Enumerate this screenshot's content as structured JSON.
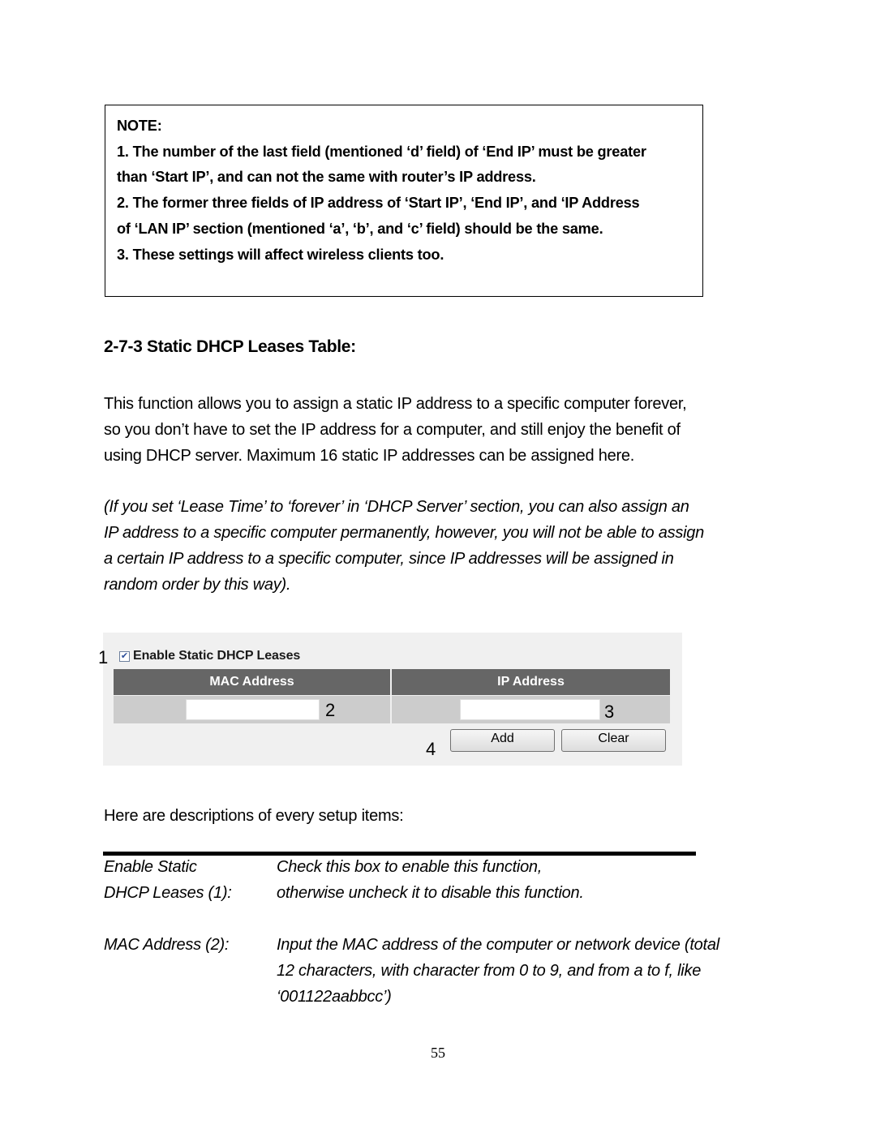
{
  "note": {
    "title": "NOTE:",
    "lines": [
      "1. The number of the last field (mentioned ‘d’ field) of ‘End IP’ must be greater",
      "than ‘Start IP’, and can not the same with router’s IP address.",
      "2. The former three fields of IP address of ‘Start IP’, ‘End IP’, and ‘IP Address",
      "of ‘LAN IP’ section (mentioned ‘a’, ‘b’, and ‘c’ field) should be the same.",
      "3. These settings will affect wireless clients too."
    ]
  },
  "section": {
    "heading": "2-7-3 Static DHCP Leases Table:",
    "intro_lines": [
      "This function allows you to assign a static IP address to a specific computer forever,",
      "so you don’t have to set the IP address for a computer, and still enjoy the benefit of",
      "using DHCP server. Maximum 16 static IP addresses can be assigned here."
    ],
    "note_lines": [
      "(If you set ‘Lease Time’ to ‘forever’ in ‘DHCP Server’ section, you can also assign an",
      "IP address to a specific computer permanently, however, you will not be able to assign",
      "a certain IP address to a specific computer, since IP addresses will be assigned in",
      "random order by this way)."
    ]
  },
  "screenshot": {
    "callouts": [
      "1",
      "2",
      "3",
      "4"
    ],
    "enable_label": "Enable Static DHCP Leases",
    "enable_checked": true,
    "checkmark": "✔",
    "columns": [
      "MAC Address",
      "IP Address"
    ],
    "mac_value": "",
    "ip_value": "",
    "buttons": {
      "add": "Add",
      "clear": "Clear"
    },
    "colors": {
      "header_bg": "#666666",
      "row_bg": "#cccccc",
      "panel_bg": "#f0f0f0"
    }
  },
  "descriptions": {
    "intro": "Here are descriptions of every setup items:",
    "items": [
      {
        "term_lines": [
          "Enable Static",
          "DHCP Leases (1):"
        ],
        "desc_lines": [
          "Check this box to enable this function,",
          "otherwise uncheck it to disable this function."
        ]
      },
      {
        "term_lines": [
          "MAC Address (2):"
        ],
        "desc_lines": [
          "Input the MAC address of the computer or network device (total",
          "12 characters, with character from 0 to 9, and from a to f, like",
          "‘001122aabbcc’)"
        ]
      }
    ]
  },
  "page_number": "55"
}
